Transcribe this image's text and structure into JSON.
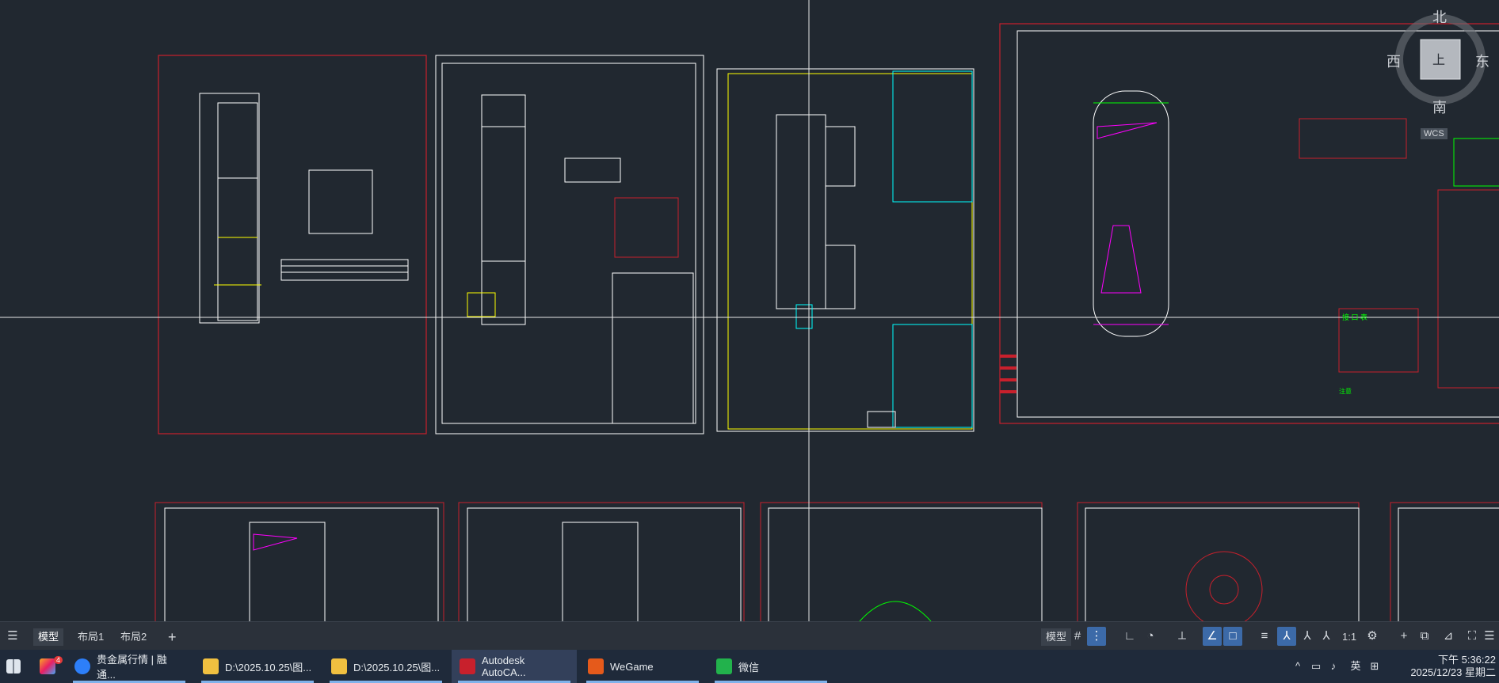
{
  "compass": {
    "north": "北",
    "south": "南",
    "east": "东",
    "west": "西",
    "top_face": "上",
    "wcs": "WCS"
  },
  "drawing_labels": {
    "section_title": "接 口 表",
    "notes_title": "注意"
  },
  "layout_tabs": [
    {
      "label": "模型",
      "active": true
    },
    {
      "label": "布局1",
      "active": false
    },
    {
      "label": "布局2",
      "active": false
    }
  ],
  "layout_add": "+",
  "status": {
    "model_label": "模型",
    "scale": "1:1"
  },
  "taskbar": {
    "apps": [
      {
        "label": "贵金属行情 | 融通...",
        "icon_color": "#2d7ff9",
        "active": false
      },
      {
        "label": "D:\\2025.10.25\\图...",
        "icon_color": "#f0c040",
        "active": false
      },
      {
        "label": "D:\\2025.10.25\\图...",
        "icon_color": "#f0c040",
        "active": false
      },
      {
        "label": "Autodesk AutoCA...",
        "icon_color": "#c8202c",
        "active": true
      },
      {
        "label": "WeGame",
        "icon_color": "#e55a1b",
        "active": false
      },
      {
        "label": "微信",
        "icon_color": "#22b24c",
        "active": false
      }
    ],
    "badge": "4",
    "ime": "英",
    "time": "下午 5:36:22",
    "date": "2025/12/23 星期二"
  },
  "colors": {
    "canvas": "#212830",
    "frame_red": "#c8202c",
    "taskbar": "#1f2a3a"
  }
}
